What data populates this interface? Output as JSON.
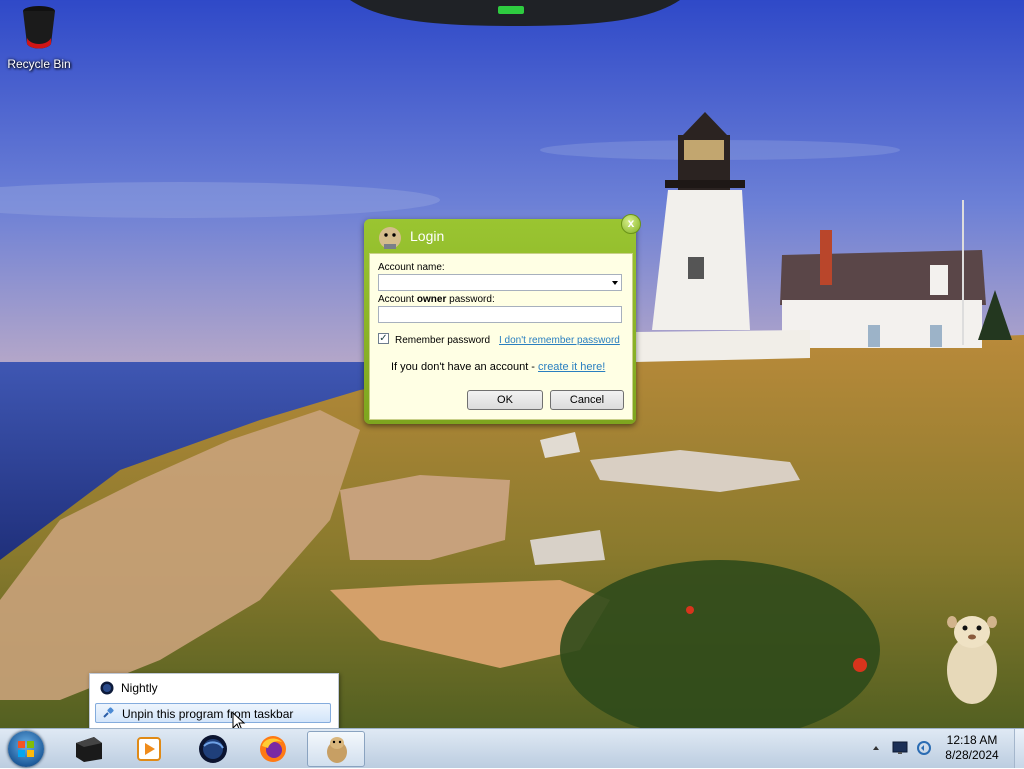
{
  "desktop": {
    "icons": [
      {
        "label": "Recycle Bin",
        "icon": "recycle-bin-icon"
      }
    ]
  },
  "login_dialog": {
    "title": "Login",
    "account_name_label": "Account name:",
    "account_name_value": "",
    "password_label_prefix": "Account ",
    "password_label_bold": "owner",
    "password_label_suffix": " password:",
    "password_value": "",
    "remember_label": "Remember password",
    "remember_checked": true,
    "forgot_link": "I don't remember password",
    "no_account_text": "If you don't have an account - ",
    "create_link": "create it here!",
    "ok_label": "OK",
    "cancel_label": "Cancel",
    "close_glyph": "x"
  },
  "jump_list": {
    "items": [
      {
        "label": "Nightly",
        "icon": "nightly-icon",
        "selected": false
      },
      {
        "label": "Unpin this program from taskbar",
        "icon": "unpin-icon",
        "selected": true
      }
    ]
  },
  "taskbar": {
    "buttons": [
      {
        "name": "start-button",
        "icon": "windows-logo-icon"
      },
      {
        "name": "app-box",
        "icon": "black-box-icon"
      },
      {
        "name": "media-player",
        "icon": "media-player-icon"
      },
      {
        "name": "nightly",
        "icon": "nightly-globe-icon"
      },
      {
        "name": "firefox",
        "icon": "firefox-icon"
      },
      {
        "name": "hamster-app",
        "icon": "hamster-icon",
        "active": true
      }
    ],
    "tray": {
      "time": "12:18 AM",
      "date": "8/28/2024"
    }
  },
  "colors": {
    "dialog_green": "#8bb82a",
    "dialog_body": "#ffffe4",
    "link": "#2a7fc0",
    "taskbar": "#cfdcea"
  }
}
